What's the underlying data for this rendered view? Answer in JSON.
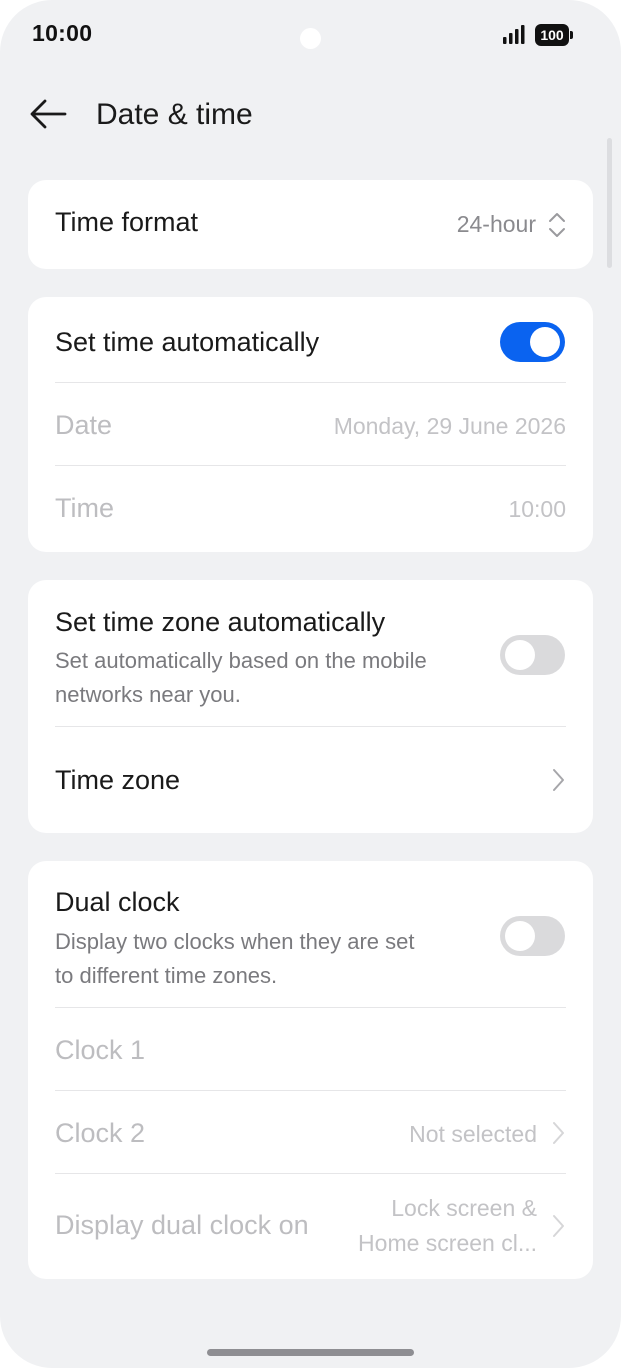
{
  "status_bar": {
    "time": "10:00",
    "battery": "100"
  },
  "header": {
    "title": "Date & time"
  },
  "colors": {
    "accent": "#0a63f0",
    "background": "#f0f1f3",
    "card": "#ffffff"
  },
  "time_format": {
    "label": "Time format",
    "value": "24-hour"
  },
  "auto_time": {
    "label": "Set time automatically",
    "toggle_on": true,
    "date_label": "Date",
    "date_value": "Monday, 29 June 2026",
    "time_label": "Time",
    "time_value": "10:00"
  },
  "auto_timezone": {
    "label": "Set time zone automatically",
    "description_line1": "Set automatically based on the mobile",
    "description_line2": "networks near you.",
    "toggle_on": false,
    "timezone_label": "Time zone"
  },
  "dual_clock": {
    "label": "Dual clock",
    "description_line1": "Display two clocks when they are set",
    "description_line2": "to different time zones.",
    "toggle_on": false,
    "clock1_label": "Clock 1",
    "clock2_label": "Clock 2",
    "clock2_value": "Not selected",
    "display_on_label": "Display dual clock on",
    "display_on_value_line1": "Lock screen &",
    "display_on_value_line2": "Home screen cl..."
  },
  "icons": [
    "back-arrow-icon",
    "signal-icon",
    "battery-icon",
    "updown-chevron-icon",
    "chevron-right-icon"
  ]
}
